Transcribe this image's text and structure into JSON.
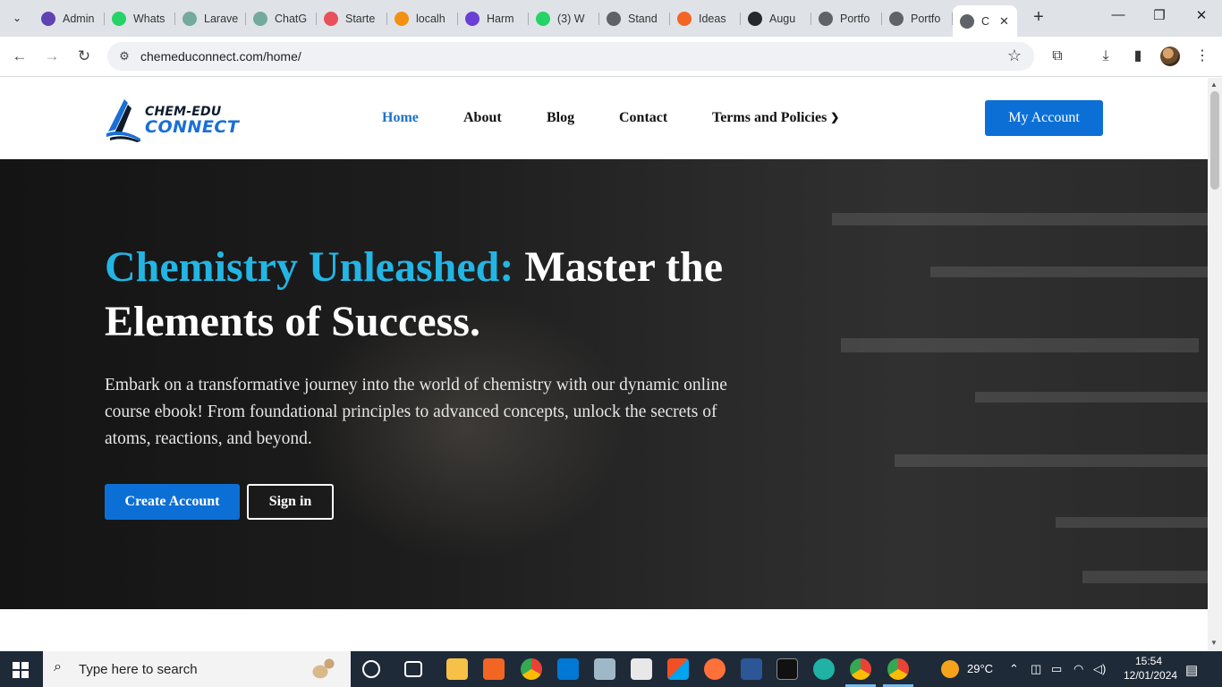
{
  "browser": {
    "tabs": [
      {
        "label": "Admin",
        "favicon_color": "#5f43b2"
      },
      {
        "label": "Whats",
        "favicon_color": "#25d366"
      },
      {
        "label": "Larave",
        "favicon_color": "#74aa9c"
      },
      {
        "label": "ChatG",
        "favicon_color": "#74aa9c"
      },
      {
        "label": "Starte",
        "favicon_color": "#e8505b"
      },
      {
        "label": "localh",
        "favicon_color": "#f29111"
      },
      {
        "label": "Harm",
        "favicon_color": "#6a3fd6"
      },
      {
        "label": "(3) W",
        "favicon_color": "#25d366"
      },
      {
        "label": "Stand",
        "favicon_color": "#5f6368"
      },
      {
        "label": "Ideas",
        "favicon_color": "#f26522"
      },
      {
        "label": "Augu",
        "favicon_color": "#24292e"
      },
      {
        "label": "Portfo",
        "favicon_color": "#5f6368"
      },
      {
        "label": "Portfo",
        "favicon_color": "#5f6368"
      }
    ],
    "active_tab": {
      "label": "C",
      "close": "✕"
    },
    "new_tab": "+",
    "url": "chemeduconnect.com/home/"
  },
  "site": {
    "logo": {
      "line1": "CHEM-EDU",
      "line2": "CONNECT"
    },
    "nav": {
      "home": "Home",
      "about": "About",
      "blog": "Blog",
      "contact": "Contact",
      "terms": "Terms and Policies"
    },
    "my_account": "My Account",
    "hero": {
      "title_accent": "Chemistry Unleashed:",
      "title_rest": " Master the Elements of Success.",
      "description": "Embark on a transformative journey into the world of chemistry with our dynamic online course ebook! From foundational principles to advanced concepts, unlock the secrets of atoms, reactions, and beyond.",
      "primary_button": "Create Account",
      "secondary_button": "Sign in"
    }
  },
  "taskbar": {
    "search_placeholder": "Type here to search",
    "weather": "29°C",
    "time": "15:54",
    "date": "12/01/2024"
  },
  "colors": {
    "accent": "#23b5e3",
    "brand_blue": "#0c6fd6",
    "nav_active": "#1f72c9"
  }
}
